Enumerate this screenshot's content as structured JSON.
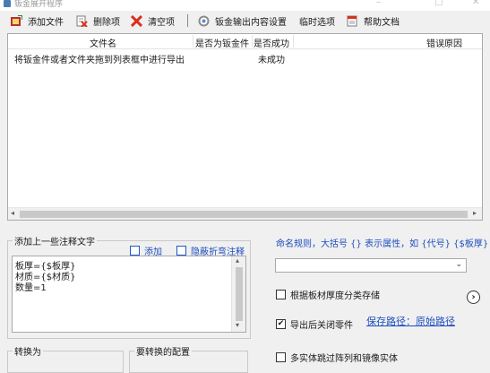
{
  "window": {
    "title": "钣金展开程序",
    "minimize_glyph": "–",
    "maximize_glyph": "□",
    "close_glyph": "✕"
  },
  "toolbar": {
    "add_file": "添加文件",
    "delete_item": "删除项",
    "clear_items": "清空项",
    "output_settings": "钣金输出内容设置",
    "temp_options": "临时选项",
    "help_doc": "帮助文档",
    "icons": [
      "add-file-icon",
      "delete-icon",
      "clear-icon",
      "settings-icon",
      "help-icon"
    ]
  },
  "file_list": {
    "columns": [
      "文件名",
      "是否为钣金件",
      "是否成功",
      "错误原因"
    ],
    "rows": [
      {
        "filename": "将钣金件或者文件夹拖到列表框中进行导出",
        "is_sheet_metal": "",
        "success": "未成功",
        "error": ""
      }
    ],
    "scroll_left_glyph": "◂",
    "scroll_right_glyph": "▸"
  },
  "annotation": {
    "group_title": "添加上一些注释文字",
    "add_label": "添加",
    "hide_bend_label": "隐蔽折弯注释",
    "lines": [
      "板厚={$板厚}",
      "材质={$材质}",
      "数量=1"
    ],
    "scroll_up_glyph": "▴",
    "scroll_down_glyph": "▾"
  },
  "naming": {
    "rule_text": "命名规则，大括号 {} 表示属性，如 {代号} {$板厚}",
    "combo_value": "",
    "combo_glyph": "⌄"
  },
  "options": {
    "classify_by_thickness": {
      "label": "根据板材厚度分类存储",
      "checked": false
    },
    "close_parts_after_export": {
      "label": "导出后关闭零件",
      "checked": true
    },
    "save_path_label": "保存路径：原始路径",
    "skip_array_mirror": {
      "label": "多实体跳过阵列和镜像实体",
      "checked": false
    },
    "more_glyph": "›",
    "check_glyph": "✔"
  },
  "bottom_groups": {
    "convert_to": "转换为",
    "configs_to_convert": "要转换的配置"
  },
  "colors": {
    "accent_blue": "#1e4fbf",
    "background": "#f0f0f0"
  }
}
